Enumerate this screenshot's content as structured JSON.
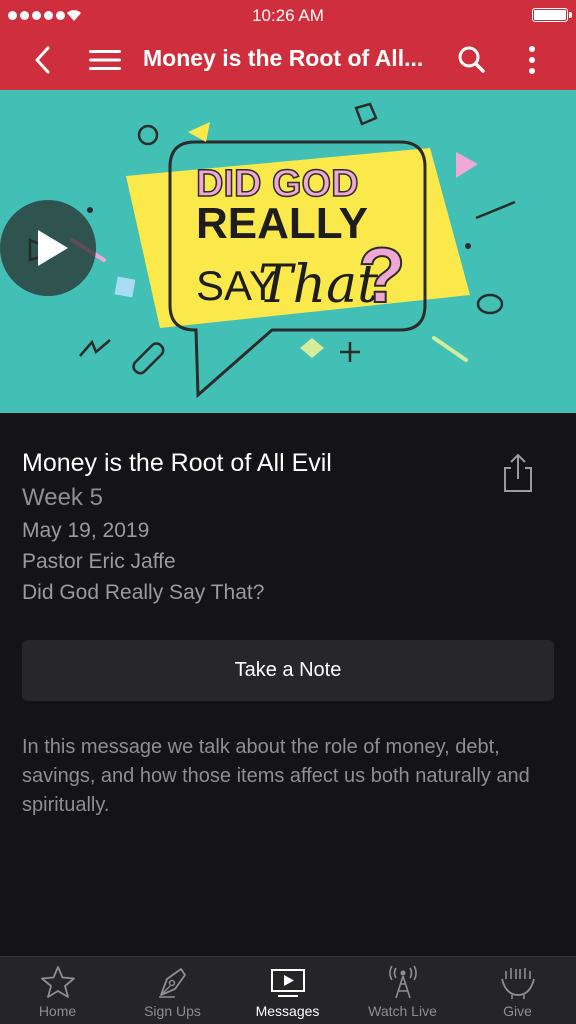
{
  "status": {
    "time": "10:26 AM"
  },
  "nav": {
    "title": "Money is the Root of All..."
  },
  "hero": {
    "line1": "DID GOD",
    "line2": "REALLY",
    "line3a": "SAY",
    "line3b": "That",
    "mark": "?"
  },
  "message": {
    "title": "Money is the Root of All Evil",
    "week": "Week 5",
    "date": "May 19, 2019",
    "pastor": "Pastor Eric Jaffe",
    "series": "Did God Really Say That?"
  },
  "note_button": "Take a Note",
  "description": "In this message we talk about the role of money, debt, savings, and how those items affect us both naturally and spiritually.",
  "tabs": [
    {
      "label": "Home",
      "icon": "star-icon"
    },
    {
      "label": "Sign Ups",
      "icon": "pen-icon"
    },
    {
      "label": "Messages",
      "icon": "video-icon"
    },
    {
      "label": "Watch Live",
      "icon": "broadcast-icon"
    },
    {
      "label": "Give",
      "icon": "hands-icon"
    }
  ],
  "active_tab": "Messages",
  "colors": {
    "brand_red": "#cf2e3c",
    "hero_teal": "#43c0b5",
    "hero_yellow": "#fbe94c",
    "hero_pink": "#f0a7d6"
  }
}
